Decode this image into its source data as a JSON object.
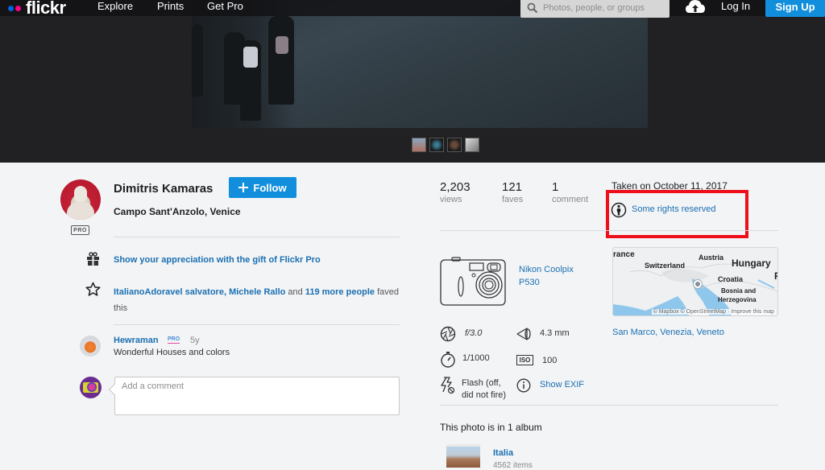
{
  "nav": {
    "brand": "flickr",
    "brand_colors": {
      "blue_dot": "#0063dc",
      "pink_dot": "#ff0084"
    },
    "links": [
      "Explore",
      "Prints",
      "Get Pro"
    ],
    "search_placeholder": "Photos, people, or groups",
    "upload_icon": "cloud-upload-icon",
    "login_label": "Log In",
    "signup_label": "Sign Up"
  },
  "photo": {
    "description": "Dark cobblestone square with pedestrians walking",
    "thumbnails": [
      "venice-canal-thumb",
      "portrait-thumb",
      "man-portrait-thumb",
      "bw-photo-thumb"
    ]
  },
  "owner": {
    "name": "Dimitris Kamaras",
    "badge": "PRO",
    "follow_label": "Follow",
    "photo_title": "Campo Sant'Anzolo, Venice"
  },
  "appreciation": {
    "gift_text": "Show your appreciation with the gift of Flickr Pro"
  },
  "faves": {
    "user1": "ItalianoAdoravel salvatore",
    "sep": ", ",
    "user2": "Michele Rallo",
    "and": " and ",
    "more": "119 more people",
    "suffix": " faved this"
  },
  "comments": [
    {
      "author": "Hewraman",
      "badge": "PRO",
      "age": "5y",
      "text": "Wonderful Houses and colors"
    }
  ],
  "comment_input": {
    "placeholder": "Add a comment"
  },
  "stats": {
    "views": {
      "value": "2,203",
      "label": "views"
    },
    "faves": {
      "value": "121",
      "label": "faves"
    },
    "comments": {
      "value": "1",
      "label": "comment"
    }
  },
  "taken_on": "Taken on October 11, 2017",
  "license": {
    "label": "Some rights reserved",
    "highlight_color": "#ee0f1a"
  },
  "camera": {
    "model": "Nikon Coolpix P530"
  },
  "map": {
    "labels": [
      "rance",
      "Austria",
      "Switzerland",
      "Hungary",
      "Croatia",
      "Bosnia and",
      "Herzegovina",
      "R"
    ],
    "attribution": "© Mapbox © OpenStreetMap · Improve this map"
  },
  "location": "San Marco, Venezia, Veneto",
  "exif": {
    "aperture": "f/3.0",
    "focal_length": "4.3 mm",
    "shutter": "1/1000",
    "iso_label": "ISO",
    "iso": "100",
    "flash": "Flash (off, did not fire)",
    "show_exif": "Show EXIF"
  },
  "albums": {
    "heading": "This photo is in 1 album",
    "items": [
      {
        "name": "Italia",
        "count": "4562 items"
      }
    ]
  },
  "colors": {
    "link": "#1c6fb1",
    "button": "#128fdc",
    "page_bg": "#f2f4f6",
    "photo_bg": "#212124"
  }
}
